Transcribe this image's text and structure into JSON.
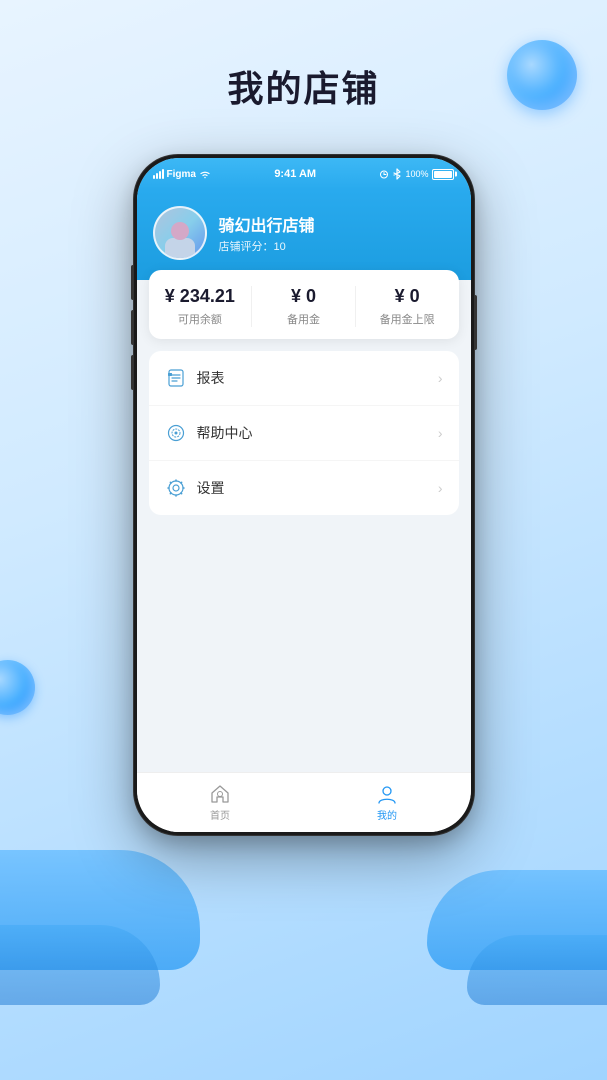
{
  "page": {
    "title": "我的店铺",
    "background_gradient_start": "#e8f4ff",
    "background_gradient_end": "#a0d4ff"
  },
  "status_bar": {
    "carrier": "Figma",
    "wifi": "wifi",
    "time": "9:41 AM",
    "bluetooth": "bluetooth",
    "battery": "100%"
  },
  "store": {
    "name": "骑幻出行店铺",
    "rating_label": "店铺评分：",
    "rating_value": "10"
  },
  "balance": {
    "available": {
      "amount": "¥ 234.21",
      "label": "可用余额"
    },
    "reserve": {
      "amount": "¥ 0",
      "label": "备用金"
    },
    "reserve_limit": {
      "amount": "¥ 0",
      "label": "备用金上限"
    }
  },
  "menu": {
    "items": [
      {
        "id": "reports",
        "label": "报表",
        "icon": "report-icon"
      },
      {
        "id": "help",
        "label": "帮助中心",
        "icon": "help-icon"
      },
      {
        "id": "settings",
        "label": "设置",
        "icon": "settings-icon"
      }
    ]
  },
  "bottom_nav": {
    "items": [
      {
        "id": "home",
        "label": "首页",
        "icon": "home-icon",
        "active": false
      },
      {
        "id": "mine",
        "label": "我的",
        "icon": "person-icon",
        "active": true
      }
    ]
  }
}
